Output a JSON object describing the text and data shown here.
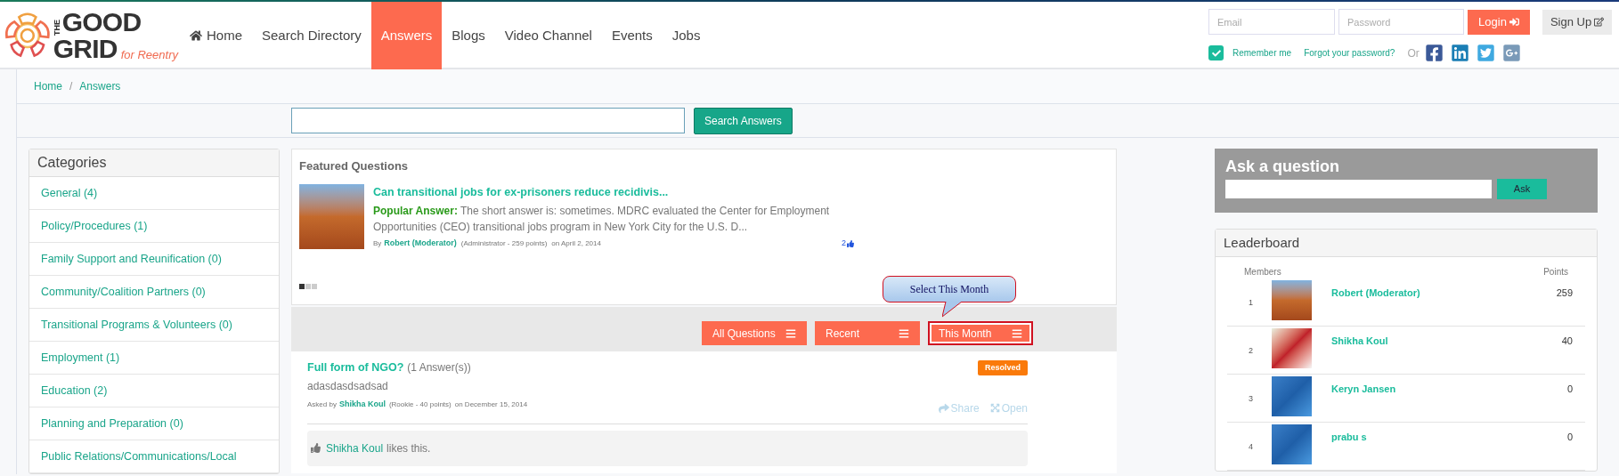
{
  "logo": {
    "the": "THE",
    "good": "GOOD",
    "grid": "GRID",
    "tagline": "for Reentry"
  },
  "nav": [
    {
      "label": "Home",
      "selected": false,
      "kind": "home"
    },
    {
      "label": "Search Directory",
      "selected": false,
      "kind": "plain"
    },
    {
      "label": "Answers",
      "selected": true,
      "kind": "plain"
    },
    {
      "label": "Blogs",
      "selected": false,
      "kind": "plain"
    },
    {
      "label": "Video Channel",
      "selected": false,
      "kind": "plain"
    },
    {
      "label": "Events",
      "selected": false,
      "kind": "plain"
    },
    {
      "label": "Jobs",
      "selected": false,
      "kind": "plain"
    }
  ],
  "login": {
    "email_placeholder": "Email",
    "password_placeholder": "Password",
    "login": "Login",
    "signup": "Sign Up",
    "remember": {
      "label": "Remember me",
      "checked": true
    },
    "forgot": "Forgot your password?",
    "or": "Or"
  },
  "breadcrumb": [
    "Home",
    "Answers"
  ],
  "breadcrumb_separator": "/",
  "search": {
    "button": "Search Answers"
  },
  "categories": {
    "title": "Categories",
    "items": [
      "General (4)",
      "Policy/Procedures (1)",
      "Family Support and Reunification (0)",
      "Community/Coalition Partners (0)",
      "Transitional Programs & Volunteers (0)",
      "Employment (1)",
      "Education (2)",
      "Planning and Preparation (0)",
      "Public Relations/Communications/Local"
    ]
  },
  "featured": {
    "title": "Featured Questions",
    "question": "Can transitional jobs for ex-prisoners reduce recidivis...",
    "answer_label": "Popular Answer:",
    "answer": "The short answer is: sometimes. MDRC evaluated the Center for Employment Opportunities (CEO) transitional jobs program in New York City for the U.S. D...",
    "by": "By",
    "author": "Robert (Moderator)",
    "role": "(Administrator - 259 points)",
    "date": "on April 2, 2014",
    "likes": "2",
    "pages": [
      {
        "selected": true
      },
      {
        "selected": false
      },
      {
        "selected": false
      }
    ]
  },
  "filters": [
    {
      "label": "All Questions",
      "highlighted": false
    },
    {
      "label": "Recent",
      "highlighted": false
    },
    {
      "label": "This Month",
      "highlighted": true
    }
  ],
  "callout": "Select This Month",
  "questions": [
    {
      "title": "Full form of NGO?",
      "answers": "(1 Answer(s))",
      "status": "Resolved",
      "body": "adasdasdsadsad",
      "asked_by": "Asked by",
      "author": "Shikha Koul",
      "role": "(Rookie - 40 points)",
      "date": "on December 15, 2014",
      "share": "Share",
      "open": "Open",
      "liker": "Shikha Koul",
      "likes_text": "likes this."
    }
  ],
  "ask": {
    "title": "Ask a question",
    "button": "Ask"
  },
  "leaderboard": {
    "title": "Leaderboard",
    "members_header": "Members",
    "points_header": "Points",
    "rows": [
      {
        "rank": "1",
        "name": "Robert (Moderator)",
        "points": "259",
        "kind": "rock"
      },
      {
        "rank": "2",
        "name": "Shikha Koul",
        "points": "40",
        "kind": "rose"
      },
      {
        "rank": "3",
        "name": "Keryn Jansen",
        "points": "0",
        "kind": "blue"
      },
      {
        "rank": "4",
        "name": "prabu s",
        "points": "0",
        "kind": "blue"
      }
    ]
  }
}
